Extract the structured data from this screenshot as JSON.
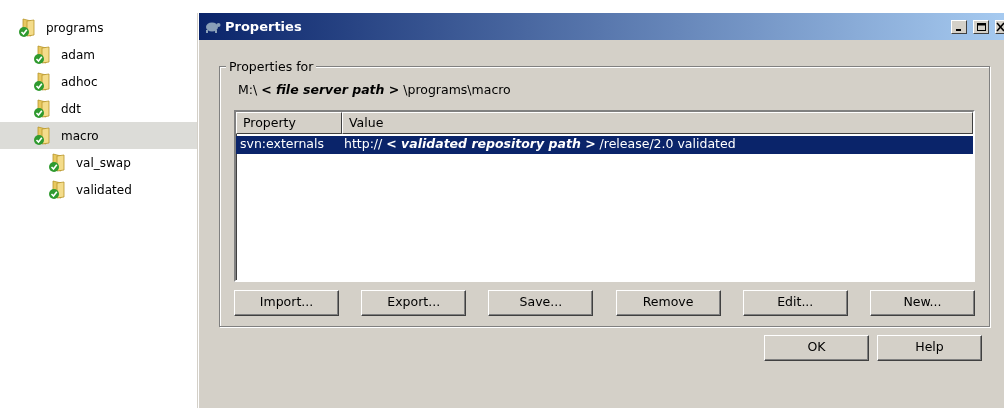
{
  "tree": [
    {
      "label": "programs",
      "selected": false,
      "children": [
        {
          "label": "adam",
          "selected": false
        },
        {
          "label": "adhoc",
          "selected": false
        },
        {
          "label": "ddt",
          "selected": false
        },
        {
          "label": "macro",
          "selected": true,
          "children": [
            {
              "label": "val_swap",
              "selected": false
            },
            {
              "label": "validated",
              "selected": false
            }
          ]
        }
      ]
    }
  ],
  "dialog": {
    "title": "Properties",
    "group_label": "Properties for",
    "path": [
      {
        "text": "M:\\ ",
        "emphasis": false
      },
      {
        "text": "< file server path >",
        "emphasis": true
      },
      {
        "text": " \\programs\\macro",
        "emphasis": false
      }
    ],
    "columns": [
      "Property",
      "Value"
    ],
    "rows": [
      {
        "property": "svn:externals",
        "value": [
          {
            "text": "http:// ",
            "emphasis": false
          },
          {
            "text": "< validated repository path >",
            "emphasis": true
          },
          {
            "text": " /release/2.0 validated",
            "emphasis": false
          }
        ],
        "selected": true
      }
    ],
    "list_buttons": [
      "Import...",
      "Export...",
      "Save...",
      "Remove",
      "Edit...",
      "New..."
    ],
    "footer_buttons": [
      "OK",
      "Help"
    ]
  }
}
